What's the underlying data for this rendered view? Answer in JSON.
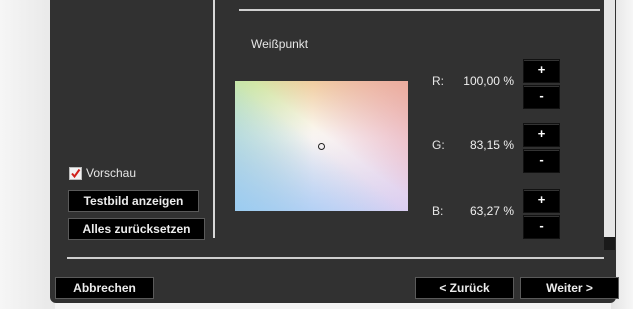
{
  "section": {
    "whitepoint_label": "Weißpunkt"
  },
  "channels": [
    {
      "label": "R:",
      "value": "100,00 %"
    },
    {
      "label": "G:",
      "value": "83,15 %"
    },
    {
      "label": "B:",
      "value": "63,27 %"
    }
  ],
  "stepper": {
    "plus": "+",
    "minus": "-"
  },
  "left_panel": {
    "preview_label": "Vorschau",
    "preview_checked": true,
    "show_test_image": "Testbild anzeigen",
    "reset_all": "Alles zurücksetzen"
  },
  "footer": {
    "cancel": "Abbrechen",
    "back": "< Zurück",
    "next": "Weiter >"
  },
  "colors": {
    "window_bg": "#313131",
    "button_bg": "#000000",
    "checkbox_mark": "#d0201a"
  },
  "icons": {
    "checkbox": "checkmark-icon",
    "marker": "whitepoint-marker-icon"
  }
}
